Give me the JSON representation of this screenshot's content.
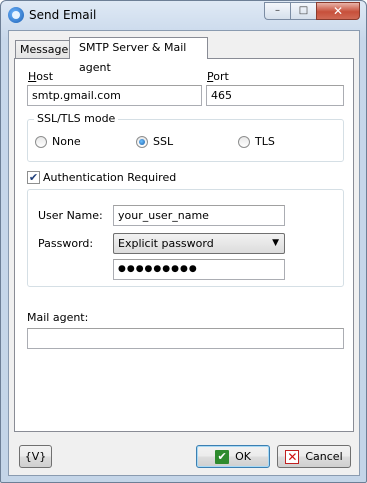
{
  "window": {
    "title": "Send Email",
    "minimize": "–",
    "maximize": "□",
    "close": "✕"
  },
  "tabs": [
    {
      "label": "Message",
      "active": false
    },
    {
      "label": "SMTP Server & Mail agent",
      "active": true
    }
  ],
  "host": {
    "label_first": "H",
    "label_rest": "ost",
    "value": "smtp.gmail.com"
  },
  "port": {
    "label_first": "P",
    "label_rest": "ort",
    "value": "465"
  },
  "ssl": {
    "title": "SSL/TLS mode",
    "options": [
      {
        "label": "None",
        "checked": false
      },
      {
        "label": "SSL",
        "checked": true
      },
      {
        "label": "TLS",
        "checked": false
      }
    ]
  },
  "auth": {
    "checkbox_label": "Authentication Required",
    "checked": true,
    "check_glyph": "✔",
    "username_label": "User Name:",
    "username_value": "your_user_name",
    "password_label": "Password:",
    "password_mode": "Explicit password",
    "password_masked": "●●●●●●●●●"
  },
  "mail_agent": {
    "label": "Mail agent:",
    "value": ""
  },
  "buttons": {
    "variables": "{V}",
    "ok": "OK",
    "cancel": "Cancel"
  },
  "icons": {
    "ok": "check-icon",
    "cancel": "cross-icon",
    "dropdown": "▼",
    "ok_glyph": "✔",
    "cancel_glyph": "✕"
  }
}
